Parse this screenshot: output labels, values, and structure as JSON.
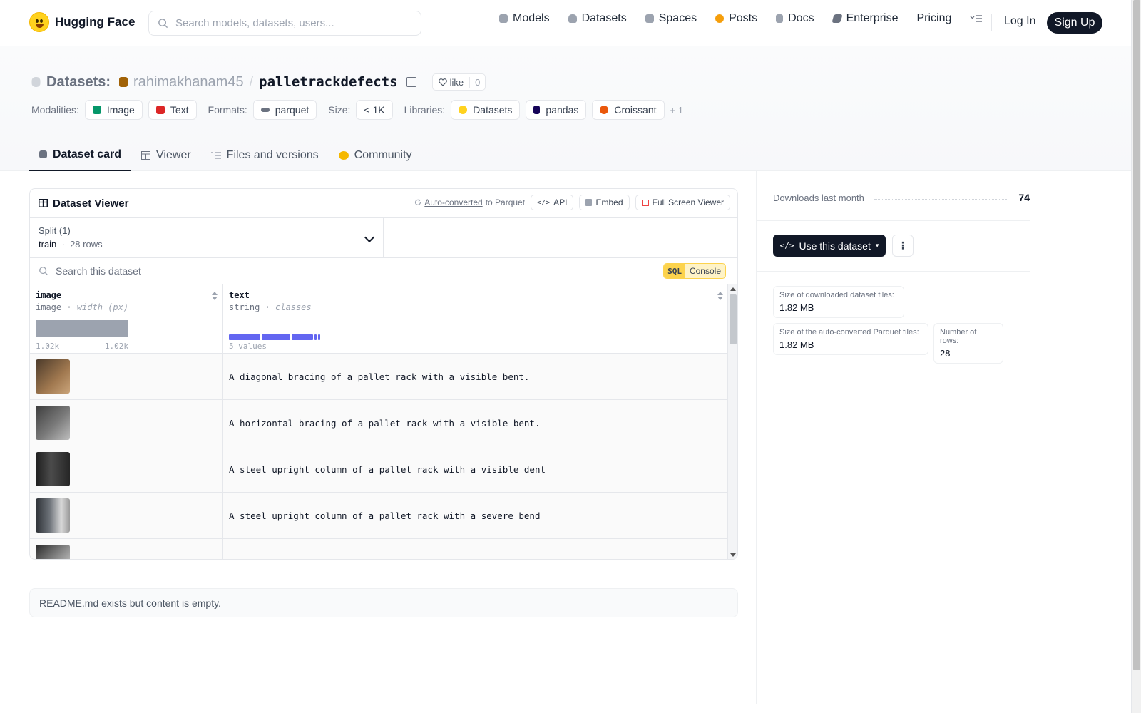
{
  "nav": {
    "brand": "Hugging Face",
    "search_placeholder": "Search models, datasets, users...",
    "links": [
      {
        "label": "Models",
        "icon": "cube-icon",
        "color": "#9ca3af"
      },
      {
        "label": "Datasets",
        "icon": "database-icon",
        "color": "#9ca3af"
      },
      {
        "label": "Spaces",
        "icon": "grid-icon",
        "color": "#9ca3af"
      },
      {
        "label": "Posts",
        "icon": "posts-icon",
        "color": "#f59e0b"
      },
      {
        "label": "Docs",
        "icon": "docs-icon",
        "color": "#9ca3af"
      },
      {
        "label": "Enterprise",
        "icon": "enterprise-icon",
        "color": "#6b7280"
      },
      {
        "label": "Pricing"
      }
    ],
    "login": "Log In",
    "signup": "Sign Up"
  },
  "header": {
    "section": "Datasets:",
    "owner": "rahimakhanam45",
    "separator": "/",
    "repo": "palletrackdefects",
    "like_label": "like",
    "like_count": "0",
    "modalities_label": "Modalities:",
    "modalities": [
      "Image",
      "Text"
    ],
    "formats_label": "Formats:",
    "formats": [
      "parquet"
    ],
    "size_label": "Size:",
    "size": "< 1K",
    "libraries_label": "Libraries:",
    "libraries": [
      "Datasets",
      "pandas",
      "Croissant"
    ],
    "more": "+ 1",
    "tabs": [
      "Dataset card",
      "Viewer",
      "Files and versions",
      "Community"
    ]
  },
  "viewer": {
    "title": "Dataset Viewer",
    "auto_converted": "Auto-converted",
    "to_parquet": "to Parquet",
    "api": "API",
    "embed": "Embed",
    "fullscreen": "Full Screen Viewer",
    "split_label": "Split (1)",
    "split_value": "train",
    "split_rows": "28 rows",
    "search_placeholder": "Search this dataset",
    "sql": "SQL",
    "console": "Console",
    "columns": [
      {
        "name": "image",
        "type": "image",
        "detail": "width (px)",
        "min": "1.02k",
        "max": "1.02k"
      },
      {
        "name": "text",
        "type": "string",
        "detail": "classes",
        "summary": "5 values"
      }
    ],
    "rows": [
      {
        "text": "A diagonal bracing of a pallet rack with a visible bent.",
        "thumb": "#8a6a4a"
      },
      {
        "text": "A horizontal bracing of a pallet rack with a visible bent.",
        "thumb": "#6b6b6b"
      },
      {
        "text": "A steel upright column of a pallet rack with a visible dent",
        "thumb": "#2f2f2f"
      },
      {
        "text": "A steel upright column of a pallet rack with a severe bend",
        "thumb": "#4a4f55"
      },
      {
        "text": "",
        "thumb": "#3a3a3a"
      }
    ]
  },
  "readme": "README.md exists but content is empty.",
  "sidebar": {
    "downloads_label": "Downloads last month",
    "downloads": "74",
    "use_button": "Use this dataset",
    "stats": [
      {
        "label": "Size of downloaded dataset files:",
        "value": "1.82 MB"
      },
      {
        "label": "Size of the auto-converted Parquet files:",
        "value": "1.82 MB"
      },
      {
        "label": "Number of rows:",
        "value": "28"
      }
    ]
  }
}
